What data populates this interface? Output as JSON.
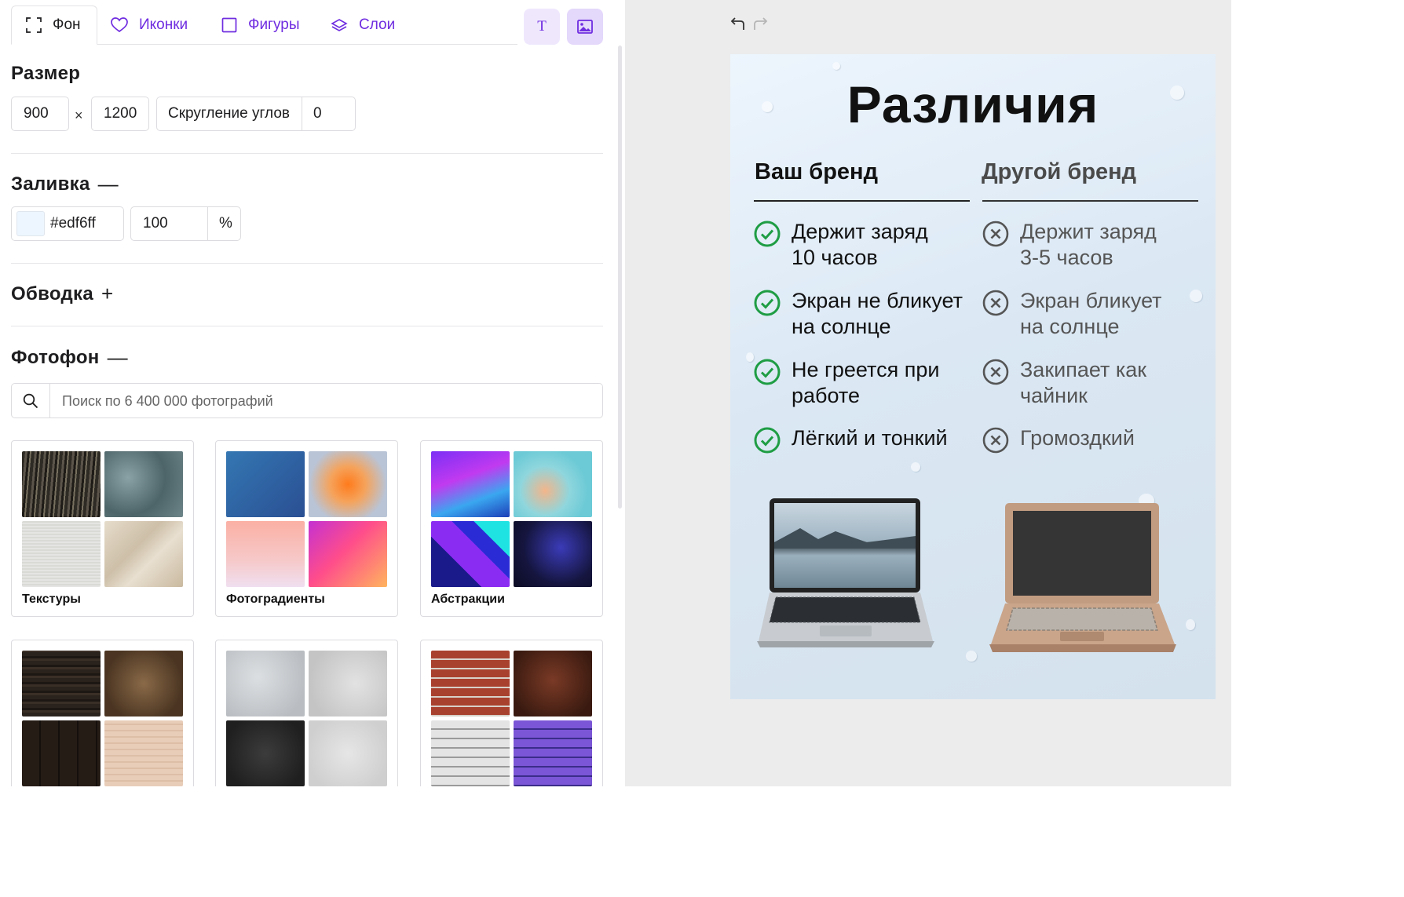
{
  "tabs": [
    {
      "label": "Фон",
      "icon": "frame-icon",
      "active": true
    },
    {
      "label": "Иконки",
      "icon": "heart-icon"
    },
    {
      "label": "Фигуры",
      "icon": "square-icon"
    },
    {
      "label": "Слои",
      "icon": "layers-icon"
    }
  ],
  "toolbar": {
    "text_button": "T",
    "image_button_icon": "image-icon"
  },
  "size": {
    "title": "Размер",
    "width": "900",
    "times": "×",
    "height": "1200",
    "corner_label": "Скругление углов",
    "corner_value": "0"
  },
  "fill": {
    "title": "Заливка",
    "toggle": "—",
    "color_hex": "#edf6ff",
    "opacity": "100",
    "unit": "%"
  },
  "stroke": {
    "title": "Обводка",
    "toggle": "+"
  },
  "photobg": {
    "title": "Фотофон",
    "toggle": "—",
    "search_placeholder": "Поиск по 6 400 000 фотографий",
    "categories": [
      {
        "label": "Текстуры"
      },
      {
        "label": "Фотоградиенты"
      },
      {
        "label": "Абстракции"
      },
      {
        "label": ""
      },
      {
        "label": ""
      },
      {
        "label": ""
      }
    ]
  },
  "canvas": {
    "undo_icon": "undo-icon",
    "redo_icon": "redo-icon",
    "poster": {
      "title": "Различия",
      "left_heading": "Ваш бренд",
      "right_heading": "Другой бренд",
      "left_items": [
        {
          "line1": "Держит заряд",
          "line2": "10 часов"
        },
        {
          "line1": "Экран не бликует",
          "line2": "на солнце"
        },
        {
          "line1": "Не греется при",
          "line2": "работе"
        },
        {
          "line1": "Лёгкий и тонкий",
          "line2": ""
        }
      ],
      "right_items": [
        {
          "line1": "Держит заряд",
          "line2": "3-5 часов"
        },
        {
          "line1": "Экран бликует",
          "line2": "на солнце"
        },
        {
          "line1": "Закипает как",
          "line2": "чайник"
        },
        {
          "line1": "Громоздкий",
          "line2": ""
        }
      ]
    }
  },
  "colors": {
    "accent": "#6f2ce0",
    "check_green": "#1f9d44",
    "cross_gray": "#555555",
    "poster_bg": "#edf6ff",
    "heading_left": "#111111",
    "heading_right": "#4a4a4a"
  }
}
